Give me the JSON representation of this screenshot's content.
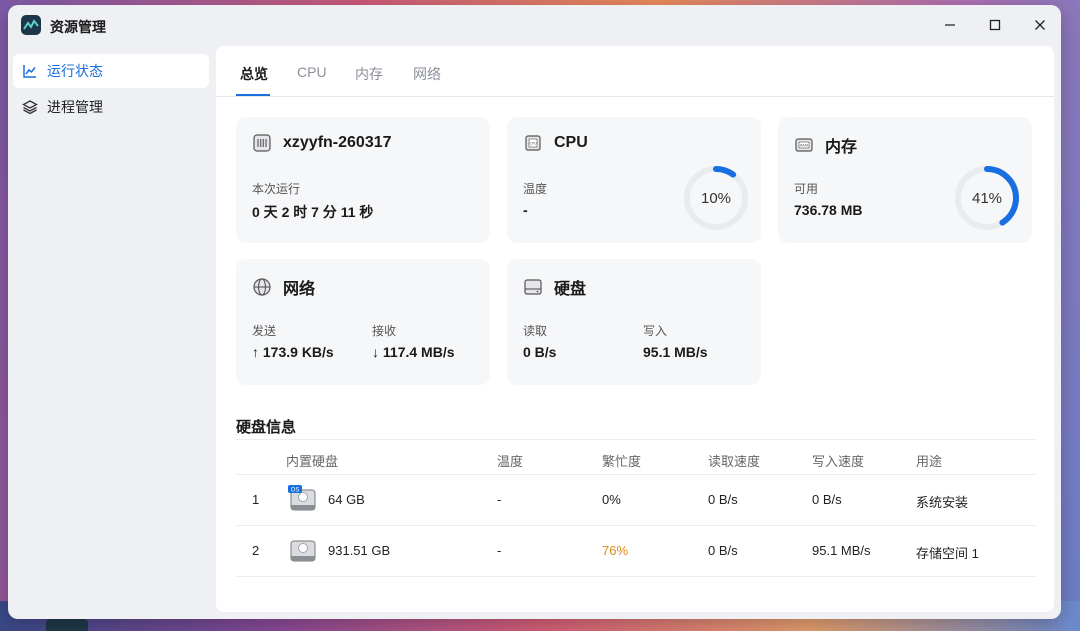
{
  "app": {
    "title": "资源管理"
  },
  "sidebar": {
    "items": [
      {
        "label": "运行状态",
        "icon": "line-chart-icon",
        "active": true
      },
      {
        "label": "进程管理",
        "icon": "layers-icon",
        "active": false
      }
    ]
  },
  "tabs": [
    {
      "label": "总览",
      "active": true
    },
    {
      "label": "CPU",
      "active": false
    },
    {
      "label": "内存",
      "active": false
    },
    {
      "label": "网络",
      "active": false
    }
  ],
  "cards": {
    "host": {
      "title": "xzyyfn-260317",
      "uptime_label": "本次运行",
      "uptime_value": "0 天 2 时 7 分 11 秒"
    },
    "cpu": {
      "title": "CPU",
      "temp_label": "温度",
      "temp_value": "-",
      "usage_text": "10%",
      "usage": 10
    },
    "memory": {
      "title": "内存",
      "avail_label": "可用",
      "avail_value": "736.78 MB",
      "usage_text": "41%",
      "usage": 41
    },
    "network": {
      "title": "网络",
      "send_label": "发送",
      "send_value": "↑ 173.9 KB/s",
      "recv_label": "接收",
      "recv_value": "↓ 117.4 MB/s"
    },
    "disk": {
      "title": "硬盘",
      "read_label": "读取",
      "read_value": "0 B/s",
      "write_label": "写入",
      "write_value": "95.1 MB/s"
    }
  },
  "disk_info": {
    "title": "硬盘信息",
    "columns": [
      "内置硬盘",
      "温度",
      "繁忙度",
      "读取速度",
      "写入速度",
      "用途"
    ],
    "rows": [
      {
        "index": "1",
        "badge": "OS",
        "size": "64 GB",
        "temp": "-",
        "busy": "0%",
        "read": "0 B/s",
        "write": "0 B/s",
        "usage": "系统安装"
      },
      {
        "index": "2",
        "badge": "",
        "size": "931.51 GB",
        "temp": "-",
        "busy": "76%",
        "read": "0 B/s",
        "write": "95.1 MB/s",
        "usage": "存储空间 1"
      }
    ]
  },
  "colors": {
    "accent": "#1a6fe0",
    "warn": "#e08a1a",
    "ring_track": "#e9ebee"
  }
}
